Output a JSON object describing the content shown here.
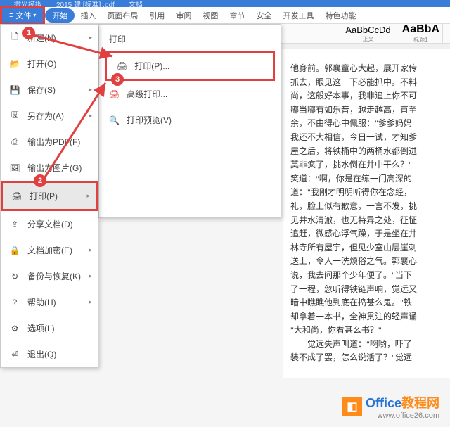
{
  "tabs": {
    "tab1": "微光模拟",
    "tab2": "2015 建 [标准] .pdf",
    "tab3": "文档"
  },
  "ribbon": {
    "file": "文件",
    "start": "开始",
    "insert": "插入",
    "layout": "页面布局",
    "refs": "引用",
    "review": "审阅",
    "view": "视图",
    "sections": "章节",
    "security": "安全",
    "devtools": "开发工具",
    "special": "特色功能"
  },
  "styles": {
    "s1_preview": "AaBbCcDd",
    "s1_label": "正文",
    "s2_preview": "AaBbA",
    "s2_label": "标题1"
  },
  "menu": {
    "new": "新建(N)",
    "open": "打开(O)",
    "save": "保存(S)",
    "saveas": "另存为(A)",
    "export_pdf": "输出为PDF(F)",
    "export_img": "输出为图片(G)",
    "print": "打印(P)",
    "share": "分享文档(D)",
    "encrypt": "文档加密(E)",
    "backup": "备份与恢复(K)",
    "help": "帮助(H)",
    "options": "选项(L)",
    "exit": "退出(Q)"
  },
  "submenu": {
    "title": "打印",
    "print": "打印(P)...",
    "adv_print": "高级打印...",
    "preview": "打印预览(V)"
  },
  "callouts": {
    "c1": "1",
    "c2": "2",
    "c3": "3"
  },
  "doc": {
    "l1": "他身前。郭襄童心大起，展开家传",
    "l2": "抓去，眼见这一下必能抓中。不料",
    "l3": "尚，这般好本事，我非追上你不可",
    "l4": "嘟当嘟有如乐音，越走越高，直至",
    "l5": "余，不由得心中佩服：\"爹爹妈妈",
    "l6": "我还不大相信，今日一试，才知爹",
    "l7": "屋之后，将铁桶中的两桶水都倒进",
    "l8": "莫非疯了，挑水倒在井中干么？\"",
    "l9": "笑道：\"啊，你是在练一门高深的",
    "l10": "道：\"我刚才明明听得你在念经，",
    "l11": "礼，脸上似有歉意，一言不发，挑",
    "l12": "见井水清澈，也无特异之处，征怔",
    "l13": "追赶，微感心浮气躁，于是坐在井",
    "l14": "林寺所有屋宇，但见少室山层崖刺",
    "l15": "送上，令人一洗烦俗之气。郭襄心",
    "l16": "说，我去问那个少年便了。\"当下",
    "l17": "了一程，忽听得铁链声响，觉远又",
    "l18": "暗中瞧瞧他到底在捣甚么鬼。\"铁",
    "l19": "却拿着一本书，全神贯注的轻声诵",
    "l20": "\"大和尚，你看甚么书？\"",
    "l21": "　　觉远失声叫道：\"啊哟，吓了",
    "l22": "装不成了罢，怎么说活了？\"觉远"
  },
  "watermark": {
    "brand": "Office",
    "suffix": "教程网",
    "url": "www.office26.com"
  }
}
